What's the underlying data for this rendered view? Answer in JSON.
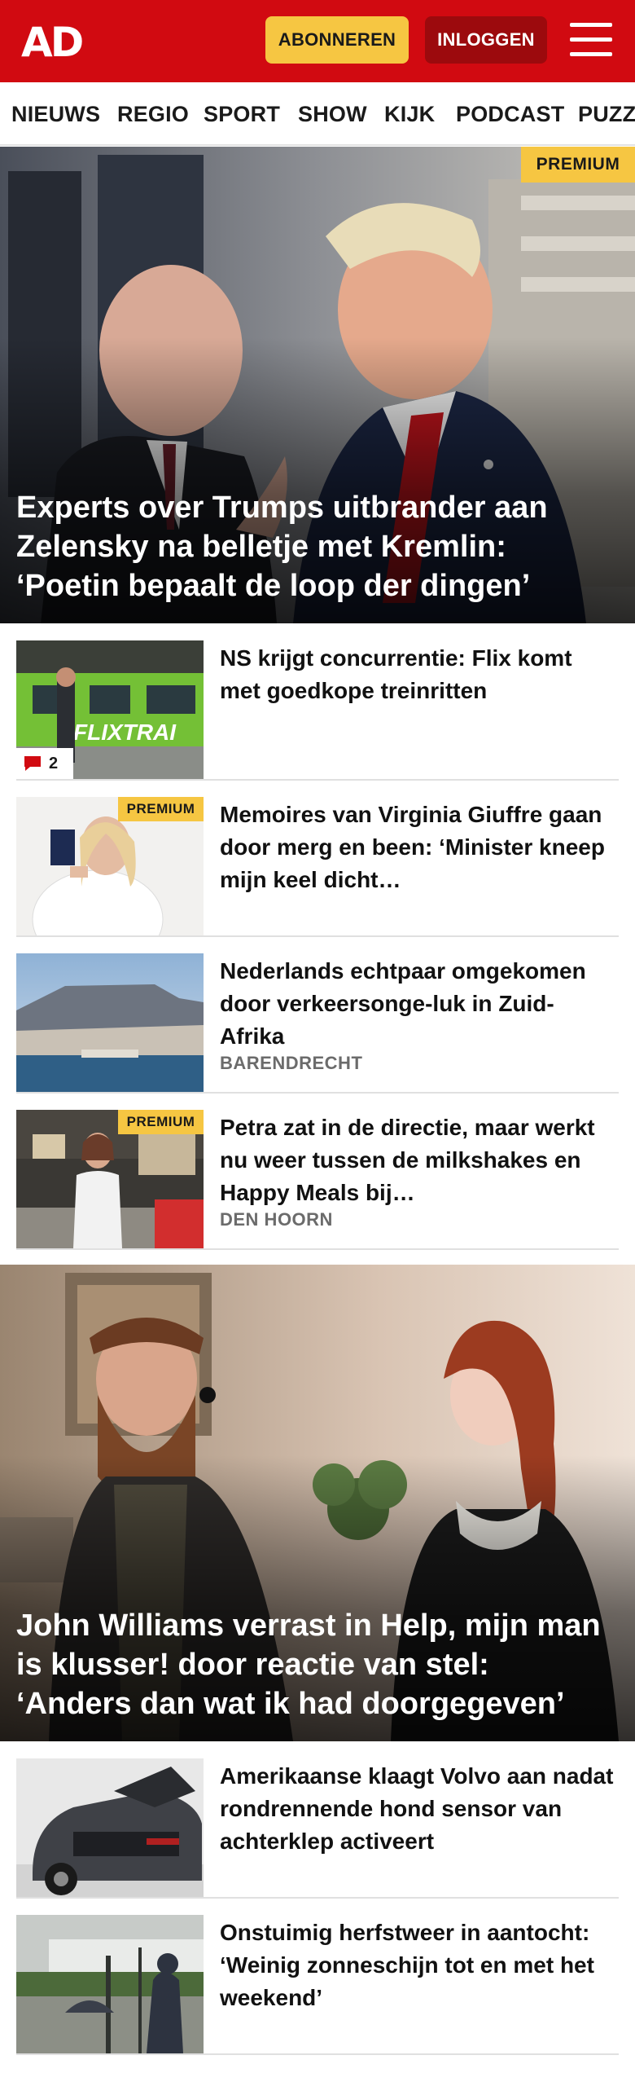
{
  "header": {
    "logo": "AD",
    "subscribe_label": "ABONNEREN",
    "login_label": "INLOGGEN",
    "menu_icon": "hamburger-menu-icon",
    "brand_color": "#d10a11",
    "accent_color": "#f6c642"
  },
  "nav": {
    "items": [
      "NIEUWS",
      "REGIO",
      "SPORT",
      "SHOW",
      "KIJK",
      "PODCAST",
      "PUZZ"
    ]
  },
  "hero1": {
    "badge": "PREMIUM",
    "title": "Experts over Trumps uitbrander aan Zelensky na belletje met Kremlin: ‘Poetin bepaalt de loop der dingen’"
  },
  "articles": [
    {
      "title": "NS krijgt concurrentie: Flix komt met goedkope treinritten",
      "comment_count": "2",
      "thumb_text": "FLIXTRAI"
    },
    {
      "badge": "PREMIUM",
      "title": "Memoires van Virginia Giuffre gaan door merg en been: ‘Minister kneep mijn keel dicht…"
    },
    {
      "title": "Nederlands echtpaar omgekomen door verkeersonge-luk in Zuid-Afrika",
      "location": "BARENDRECHT"
    },
    {
      "badge": "PREMIUM",
      "title": "Petra zat in de directie, maar werkt nu weer tussen de milkshakes en Happy Meals bij…",
      "location": "DEN HOORN"
    }
  ],
  "hero2": {
    "title": "John Williams verrast in Help, mijn man is klusser! door reactie van stel: ‘Anders dan wat ik had doorgegeven’"
  },
  "articles2": [
    {
      "title": "Amerikaanse klaagt Volvo aan nadat rondrennende hond sensor van achterklep activeert"
    },
    {
      "title": "Onstuimig herfstweer in aantocht: ‘Weinig zonneschijn tot en met het weekend’"
    }
  ]
}
